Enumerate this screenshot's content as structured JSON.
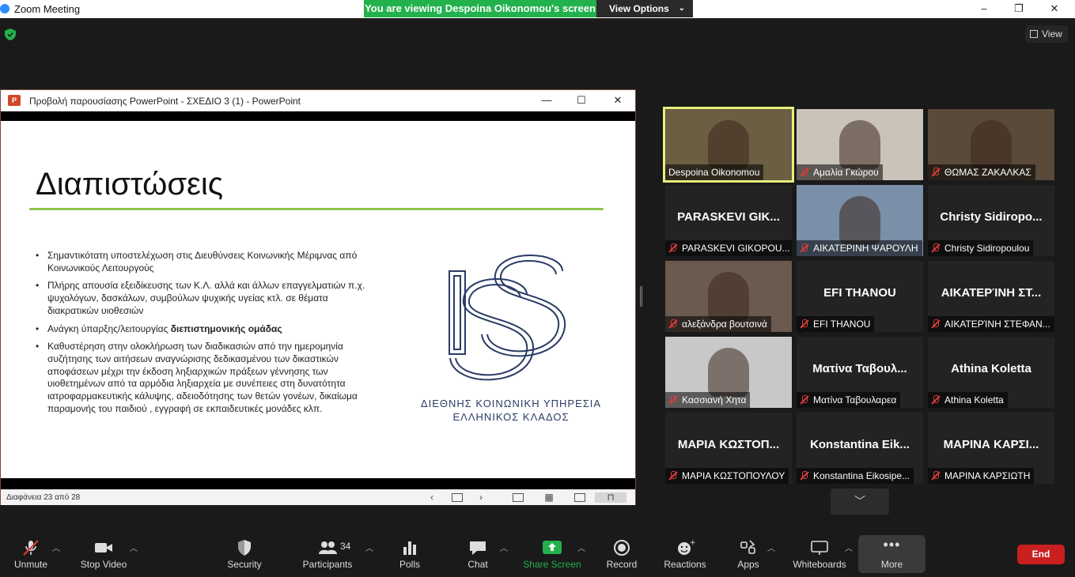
{
  "window": {
    "title": "Zoom Meeting",
    "controls": [
      "–",
      "❐",
      "✕"
    ]
  },
  "banner": {
    "viewing": "You are viewing Despoina Oikonomou's screen",
    "options": "View Options"
  },
  "view_button": "View",
  "ppt": {
    "window_title": "Προβολή παρουσίασης PowerPoint  -  ΣΧΕΔΙΟ 3 (1) - PowerPoint",
    "slide_status": "Διαφάνεια 23 από 28",
    "slide": {
      "heading": "Διαπιστώσεις",
      "bullets": [
        {
          "text": "Σημαντικότατη υποστελέχωση στις Διευθύνσεις Κοινωνικής Μέριμνας από Κοινωνικούς Λειτουργούς",
          "bold": ""
        },
        {
          "text": "Πλήρης απουσία εξειδίκευσης των Κ.Λ. αλλά και άλλων επαγγελματιών π.χ. ψυχολόγων, δασκάλων, συμβούλων ψυχικής υγείας κτλ. σε θέματα διακρατικών υιοθεσιών",
          "bold": ""
        },
        {
          "text": "Ανάγκη ύπαρξης/λειτουργίας ",
          "bold": "διεπιστημονικής ομάδας"
        },
        {
          "text": "Καθυστέρηση στην ολοκλήρωση των διαδικασιών από την ημερομηνία συζήτησης των αιτήσεων αναγνώρισης δεδικασμένου των δικαστικών αποφάσεων μέχρι την έκδοση ληξιαρχικών πράξεων γέννησης των υιοθετημένων από τα αρμόδια ληξιαρχεία με συνέπειες στη δυνατότητα ιατροφαρμακευτικής κάλυψης, αδειοδότησης των θετών γονέων, δικαίωμα παραμονής του παιδιού , εγγραφή σε εκπαιδευτικές μονάδες κλπ.",
          "bold": ""
        }
      ],
      "logo_line1": "ΔΙΕΘΝΗΣ ΚΟΙΝΩΝΙΚΗ ΥΠΗΡΕΣΙΑ",
      "logo_line2": "ΕΛΛΗΝΙΚΟΣ ΚΛΑΔΟΣ"
    }
  },
  "participants": [
    {
      "name": "Despoina Oikonomou",
      "muted": false,
      "video": true,
      "active": true,
      "bg": "#6b5e43"
    },
    {
      "name": "Αμαλία Γκώρου",
      "muted": true,
      "video": true,
      "active": false,
      "bg": "#c9c3ba"
    },
    {
      "name": "ΘΩΜΑΣ ΖΑΚΑΛΚΑΣ",
      "muted": true,
      "video": true,
      "active": false,
      "bg": "#5a4a3a"
    },
    {
      "name": "PARASKEVI GIKOPOU...",
      "big": "PARASKEVI GIK...",
      "muted": true,
      "video": false
    },
    {
      "name": "ΑΙΚΑΤΕΡΙΝΗ ΨΑΡΟΥΛΗ",
      "muted": true,
      "video": true,
      "active": false,
      "bg": "#7a8fa8"
    },
    {
      "name": "Christy Sidiropoulou",
      "big": "Christy  Sidiropo...",
      "muted": true,
      "video": false
    },
    {
      "name": "αλεξάνδρα βουτσινά",
      "muted": true,
      "video": true,
      "active": false,
      "bg": "#6a5a50"
    },
    {
      "name": "EFI THANOU",
      "big": "EFI THANOU",
      "muted": true,
      "video": false
    },
    {
      "name": "ΑΙΚΑΤΕΡΊΝΗ ΣΤΕΦΑΝ...",
      "big": "ΑΙΚΑΤΕΡΊΝΗ ΣΤ...",
      "muted": true,
      "video": false
    },
    {
      "name": "Κασσιανή Χητα",
      "muted": true,
      "video": true,
      "active": false,
      "bg": "#c8c8c8"
    },
    {
      "name": "Ματίνα Ταβουλαρεα",
      "big": "Ματίνα Ταβουλ...",
      "muted": true,
      "video": false
    },
    {
      "name": "Athina Koletta",
      "big": "Athina Koletta",
      "muted": true,
      "video": false
    },
    {
      "name": "ΜΑΡΙΑ ΚΩΣΤΟΠΟΥΛΟΥ",
      "big": "ΜΑΡΙΑ  ΚΩΣΤΟΠ...",
      "muted": true,
      "video": false
    },
    {
      "name": "Konstantina Eikosipe...",
      "big": "Konstantina  Eik...",
      "muted": true,
      "video": false
    },
    {
      "name": "ΜΑΡΙΝΑ ΚΑΡΣΙΩΤΗ",
      "big": "ΜΑΡΙΝΑ  ΚΑΡΣΙ...",
      "muted": true,
      "video": false
    }
  ],
  "toolbar": {
    "unmute": "Unmute",
    "stop_video": "Stop Video",
    "security": "Security",
    "participants": "Participants",
    "participants_count": "34",
    "polls": "Polls",
    "chat": "Chat",
    "share_screen": "Share Screen",
    "record": "Record",
    "reactions": "Reactions",
    "apps": "Apps",
    "whiteboards": "Whiteboards",
    "more": "More",
    "end": "End"
  },
  "colors": {
    "share_green": "#23b14d",
    "active_speaker": "#e4ef79",
    "end_red": "#c91f1f",
    "slide_rule": "#8bc34a"
  }
}
